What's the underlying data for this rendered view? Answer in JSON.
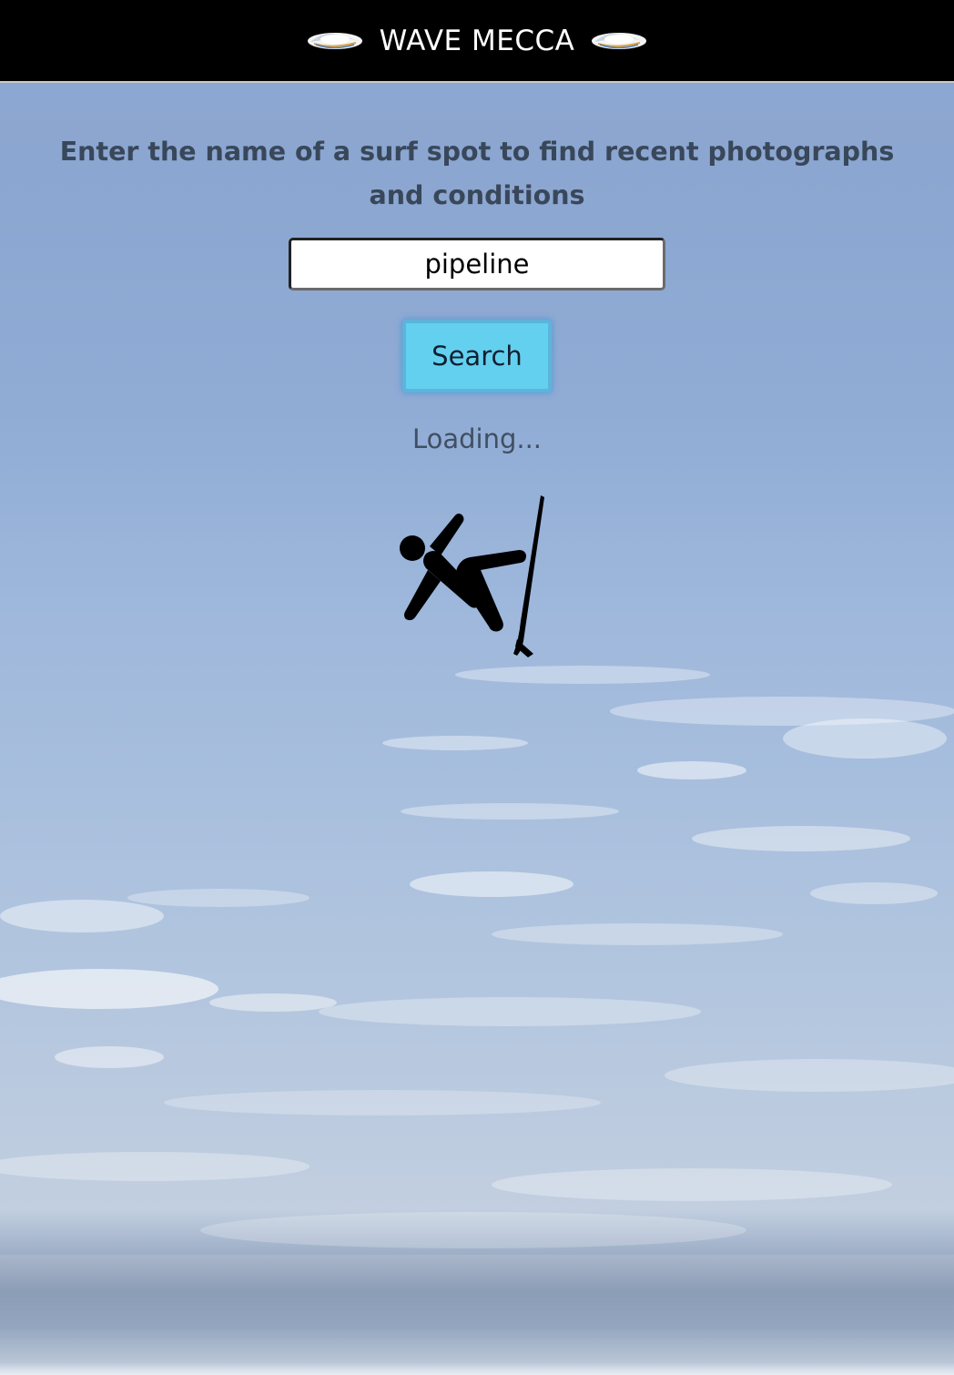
{
  "header": {
    "title": "WAVE MECCA",
    "logo_left_icon": "wave-logo-icon",
    "logo_right_icon": "wave-logo-icon"
  },
  "main": {
    "instructions": "Enter the name of a surf spot to find recent photographs and conditions",
    "search": {
      "value": "pipeline",
      "placeholder": ""
    },
    "search_button_label": "Search",
    "loading_text": "Loading...",
    "loading_icon": "falling-surfer-icon"
  },
  "colors": {
    "header_bg": "#000000",
    "button_bg": "#63d0ef",
    "text_dark": "#39475a"
  }
}
